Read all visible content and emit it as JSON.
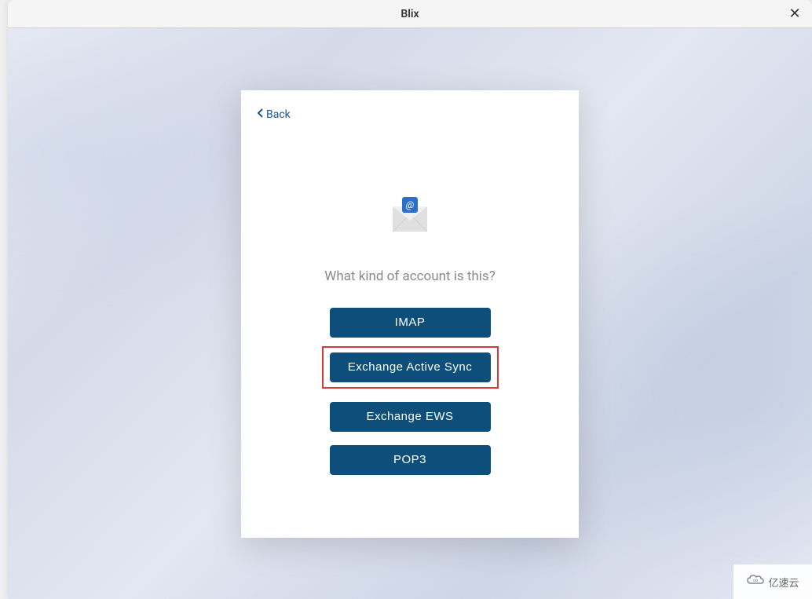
{
  "window": {
    "title": "Blix",
    "close_symbol": "✕"
  },
  "modal": {
    "back_label": "Back",
    "question": "What kind of account is this?",
    "options": {
      "imap": "IMAP",
      "eas": "Exchange Active Sync",
      "ews": "Exchange EWS",
      "pop3": "POP3"
    },
    "highlighted_option": "eas"
  },
  "watermark": {
    "text": "亿速云"
  }
}
